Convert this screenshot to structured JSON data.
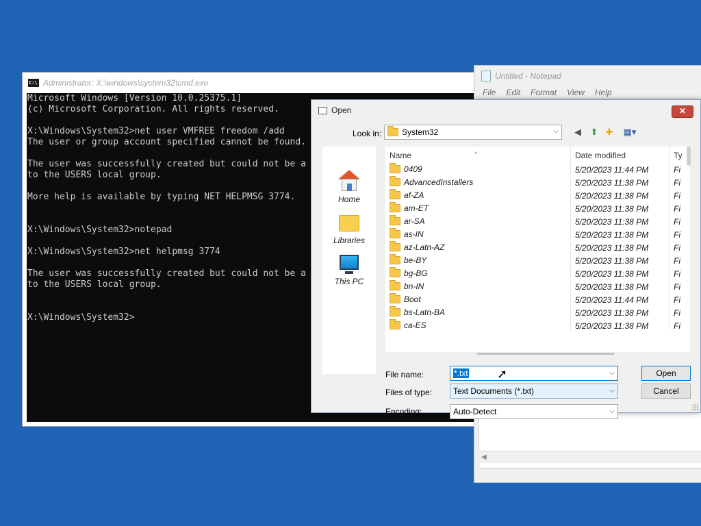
{
  "cmd": {
    "title": "Administrator: X:\\windows\\system32\\cmd.exe",
    "lines": [
      "Microsoft Windows [Version 10.0.25375.1]",
      "(c) Microsoft Corporation. All rights reserved.",
      "",
      "X:\\Windows\\System32>net user VMFREE freedom /add",
      "The user or group account specified cannot be found.",
      "",
      "The user was successfully created but could not be a",
      "to the USERS local group.",
      "",
      "More help is available by typing NET HELPMSG 3774.",
      "",
      "",
      "X:\\Windows\\System32>notepad",
      "",
      "X:\\Windows\\System32>net helpmsg 3774",
      "",
      "The user was successfully created but could not be a",
      "to the USERS local group.",
      "",
      "",
      "X:\\Windows\\System32>"
    ]
  },
  "notepad": {
    "title": "Untitled - Notepad",
    "menu": [
      "File",
      "Edit",
      "Format",
      "View",
      "Help"
    ]
  },
  "dialog": {
    "title": "Open",
    "close_label": "✕",
    "look_in_label": "Look in:",
    "look_in_value": "System32",
    "places": [
      {
        "label": "Home",
        "icon": "home-icon"
      },
      {
        "label": "Libraries",
        "icon": "libraries-icon"
      },
      {
        "label": "This PC",
        "icon": "this-pc-icon"
      }
    ],
    "columns": [
      "Name",
      "Date modified",
      "Ty"
    ],
    "files": [
      {
        "name": "0409",
        "date": "5/20/2023 11:44 PM",
        "type": "Fi"
      },
      {
        "name": "AdvancedInstallers",
        "date": "5/20/2023 11:38 PM",
        "type": "Fi"
      },
      {
        "name": "af-ZA",
        "date": "5/20/2023 11:38 PM",
        "type": "Fi"
      },
      {
        "name": "am-ET",
        "date": "5/20/2023 11:38 PM",
        "type": "Fi"
      },
      {
        "name": "ar-SA",
        "date": "5/20/2023 11:38 PM",
        "type": "Fi"
      },
      {
        "name": "as-IN",
        "date": "5/20/2023 11:38 PM",
        "type": "Fi"
      },
      {
        "name": "az-Latn-AZ",
        "date": "5/20/2023 11:38 PM",
        "type": "Fi"
      },
      {
        "name": "be-BY",
        "date": "5/20/2023 11:38 PM",
        "type": "Fi"
      },
      {
        "name": "bg-BG",
        "date": "5/20/2023 11:38 PM",
        "type": "Fi"
      },
      {
        "name": "bn-IN",
        "date": "5/20/2023 11:38 PM",
        "type": "Fi"
      },
      {
        "name": "Boot",
        "date": "5/20/2023 11:44 PM",
        "type": "Fi"
      },
      {
        "name": "bs-Latn-BA",
        "date": "5/20/2023 11:38 PM",
        "type": "Fi"
      },
      {
        "name": "ca-ES",
        "date": "5/20/2023 11:38 PM",
        "type": "Fi"
      }
    ],
    "file_name_label": "File name:",
    "file_name_value": "*.txt",
    "files_of_type_label": "Files of type:",
    "files_of_type_value": "Text Documents (*.txt)",
    "encoding_label": "Encoding:",
    "encoding_value": "Auto-Detect",
    "open_label": "Open",
    "cancel_label": "Cancel"
  }
}
